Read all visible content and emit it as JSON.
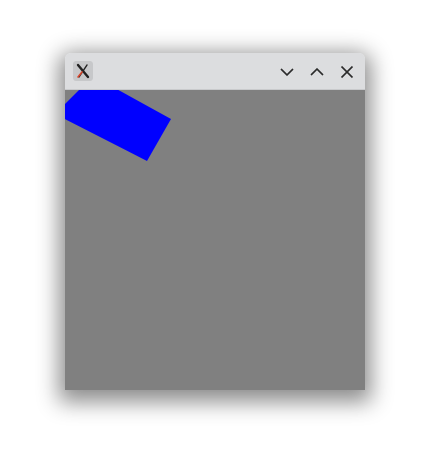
{
  "window": {
    "app_icon": "x-window-system-icon",
    "controls": [
      {
        "name": "minimize",
        "icon": "chevron-down-icon"
      },
      {
        "name": "maximize",
        "icon": "chevron-up-icon"
      },
      {
        "name": "close",
        "icon": "close-icon"
      }
    ]
  },
  "canvas": {
    "background": "#808080",
    "shape": {
      "kind": "rotated-rectangle",
      "color": "#0000ff"
    }
  }
}
